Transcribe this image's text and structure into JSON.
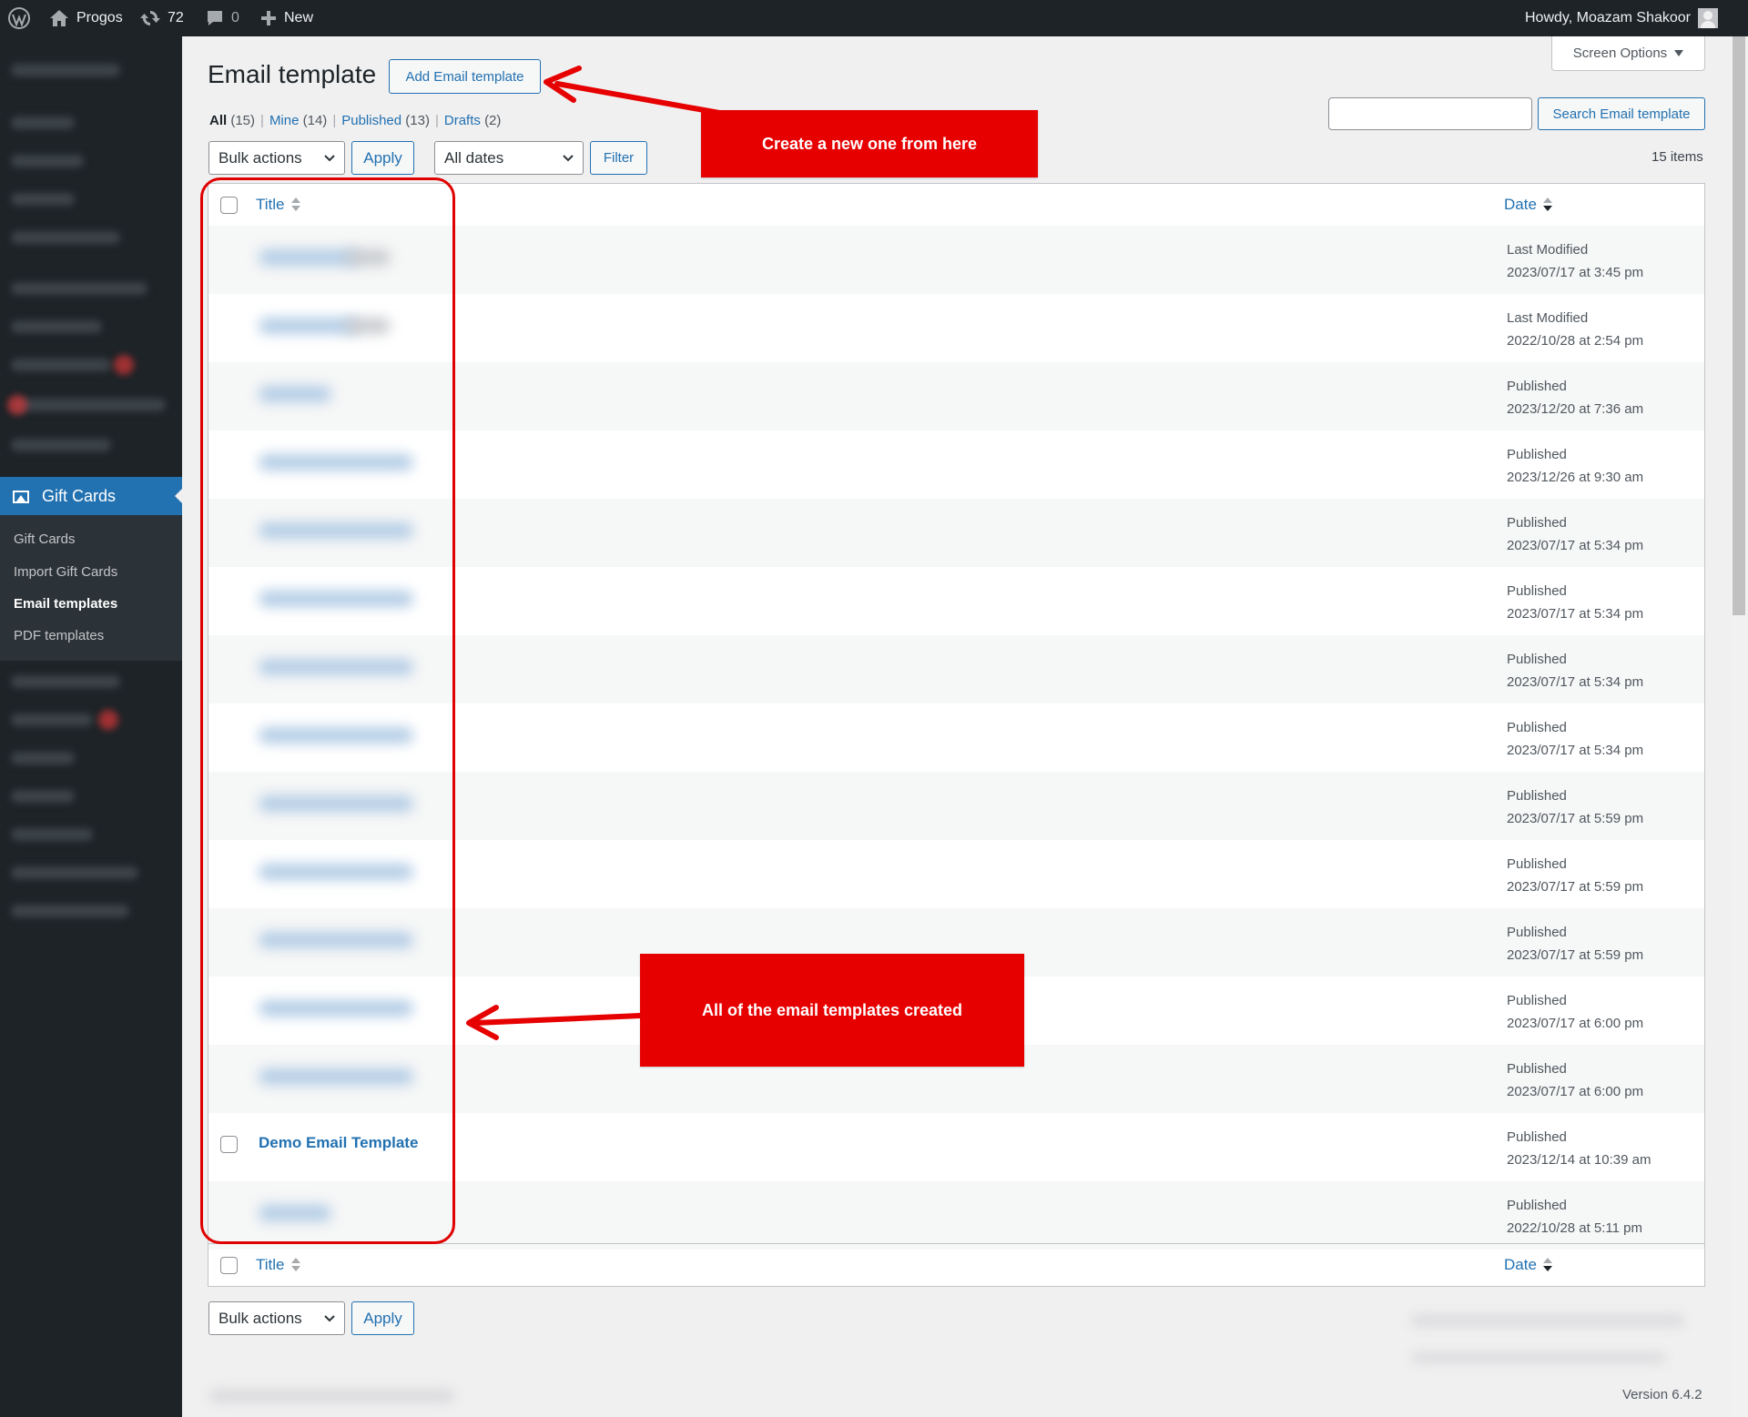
{
  "admin_bar": {
    "site_name": "Progos",
    "updates_count": "72",
    "comments_count": "0",
    "new_label": "New",
    "greeting": "Howdy, Moazam Shakoor"
  },
  "sidebar": {
    "current_menu": "Gift Cards",
    "submenu": [
      {
        "label": "Gift Cards"
      },
      {
        "label": "Import Gift Cards"
      },
      {
        "label": "Email templates"
      },
      {
        "label": "PDF templates"
      }
    ]
  },
  "header": {
    "title": "Email template",
    "add_button": "Add Email template",
    "screen_options": "Screen Options"
  },
  "views": {
    "all": "All",
    "all_count": "(15)",
    "mine": "Mine",
    "mine_count": "(14)",
    "published": "Published",
    "published_count": "(13)",
    "drafts": "Drafts",
    "drafts_count": "(2)",
    "separator": "|"
  },
  "search": {
    "value": "",
    "button": "Search Email template"
  },
  "toolbar": {
    "bulk_actions": "Bulk actions",
    "apply": "Apply",
    "dates": "All dates",
    "filter": "Filter",
    "items_count": "15 items"
  },
  "table": {
    "col_title": "Title",
    "col_date": "Date",
    "rows": [
      {
        "title": "",
        "status": "Last Modified",
        "date": "2023/07/17 at 3:45 pm"
      },
      {
        "title": "",
        "status": "Last Modified",
        "date": "2022/10/28 at 2:54 pm"
      },
      {
        "title": "",
        "status": "Published",
        "date": "2023/12/20 at 7:36 am"
      },
      {
        "title": "",
        "status": "Published",
        "date": "2023/12/26 at 9:30 am"
      },
      {
        "title": "",
        "status": "Published",
        "date": "2023/07/17 at 5:34 pm"
      },
      {
        "title": "",
        "status": "Published",
        "date": "2023/07/17 at 5:34 pm"
      },
      {
        "title": "",
        "status": "Published",
        "date": "2023/07/17 at 5:34 pm"
      },
      {
        "title": "",
        "status": "Published",
        "date": "2023/07/17 at 5:34 pm"
      },
      {
        "title": "",
        "status": "Published",
        "date": "2023/07/17 at 5:59 pm"
      },
      {
        "title": "",
        "status": "Published",
        "date": "2023/07/17 at 5:59 pm"
      },
      {
        "title": "",
        "status": "Published",
        "date": "2023/07/17 at 5:59 pm"
      },
      {
        "title": "",
        "status": "Published",
        "date": "2023/07/17 at 6:00 pm"
      },
      {
        "title": "",
        "status": "Published",
        "date": "2023/07/17 at 6:00 pm"
      },
      {
        "title": "Demo Email Template",
        "status": "Published",
        "date": "2023/12/14 at 10:39 am"
      },
      {
        "title": "",
        "status": "Published",
        "date": "2022/10/28 at 5:11 pm"
      }
    ]
  },
  "footer": {
    "version": "Version 6.4.2"
  },
  "annotations": {
    "create_callout": "Create a new one from here",
    "list_callout": "All of the email templates created",
    "color": "#e60000"
  },
  "colors": {
    "accent": "#2271b1",
    "admin_bar_bg": "#1d2327",
    "page_bg": "#f0f0f1"
  }
}
